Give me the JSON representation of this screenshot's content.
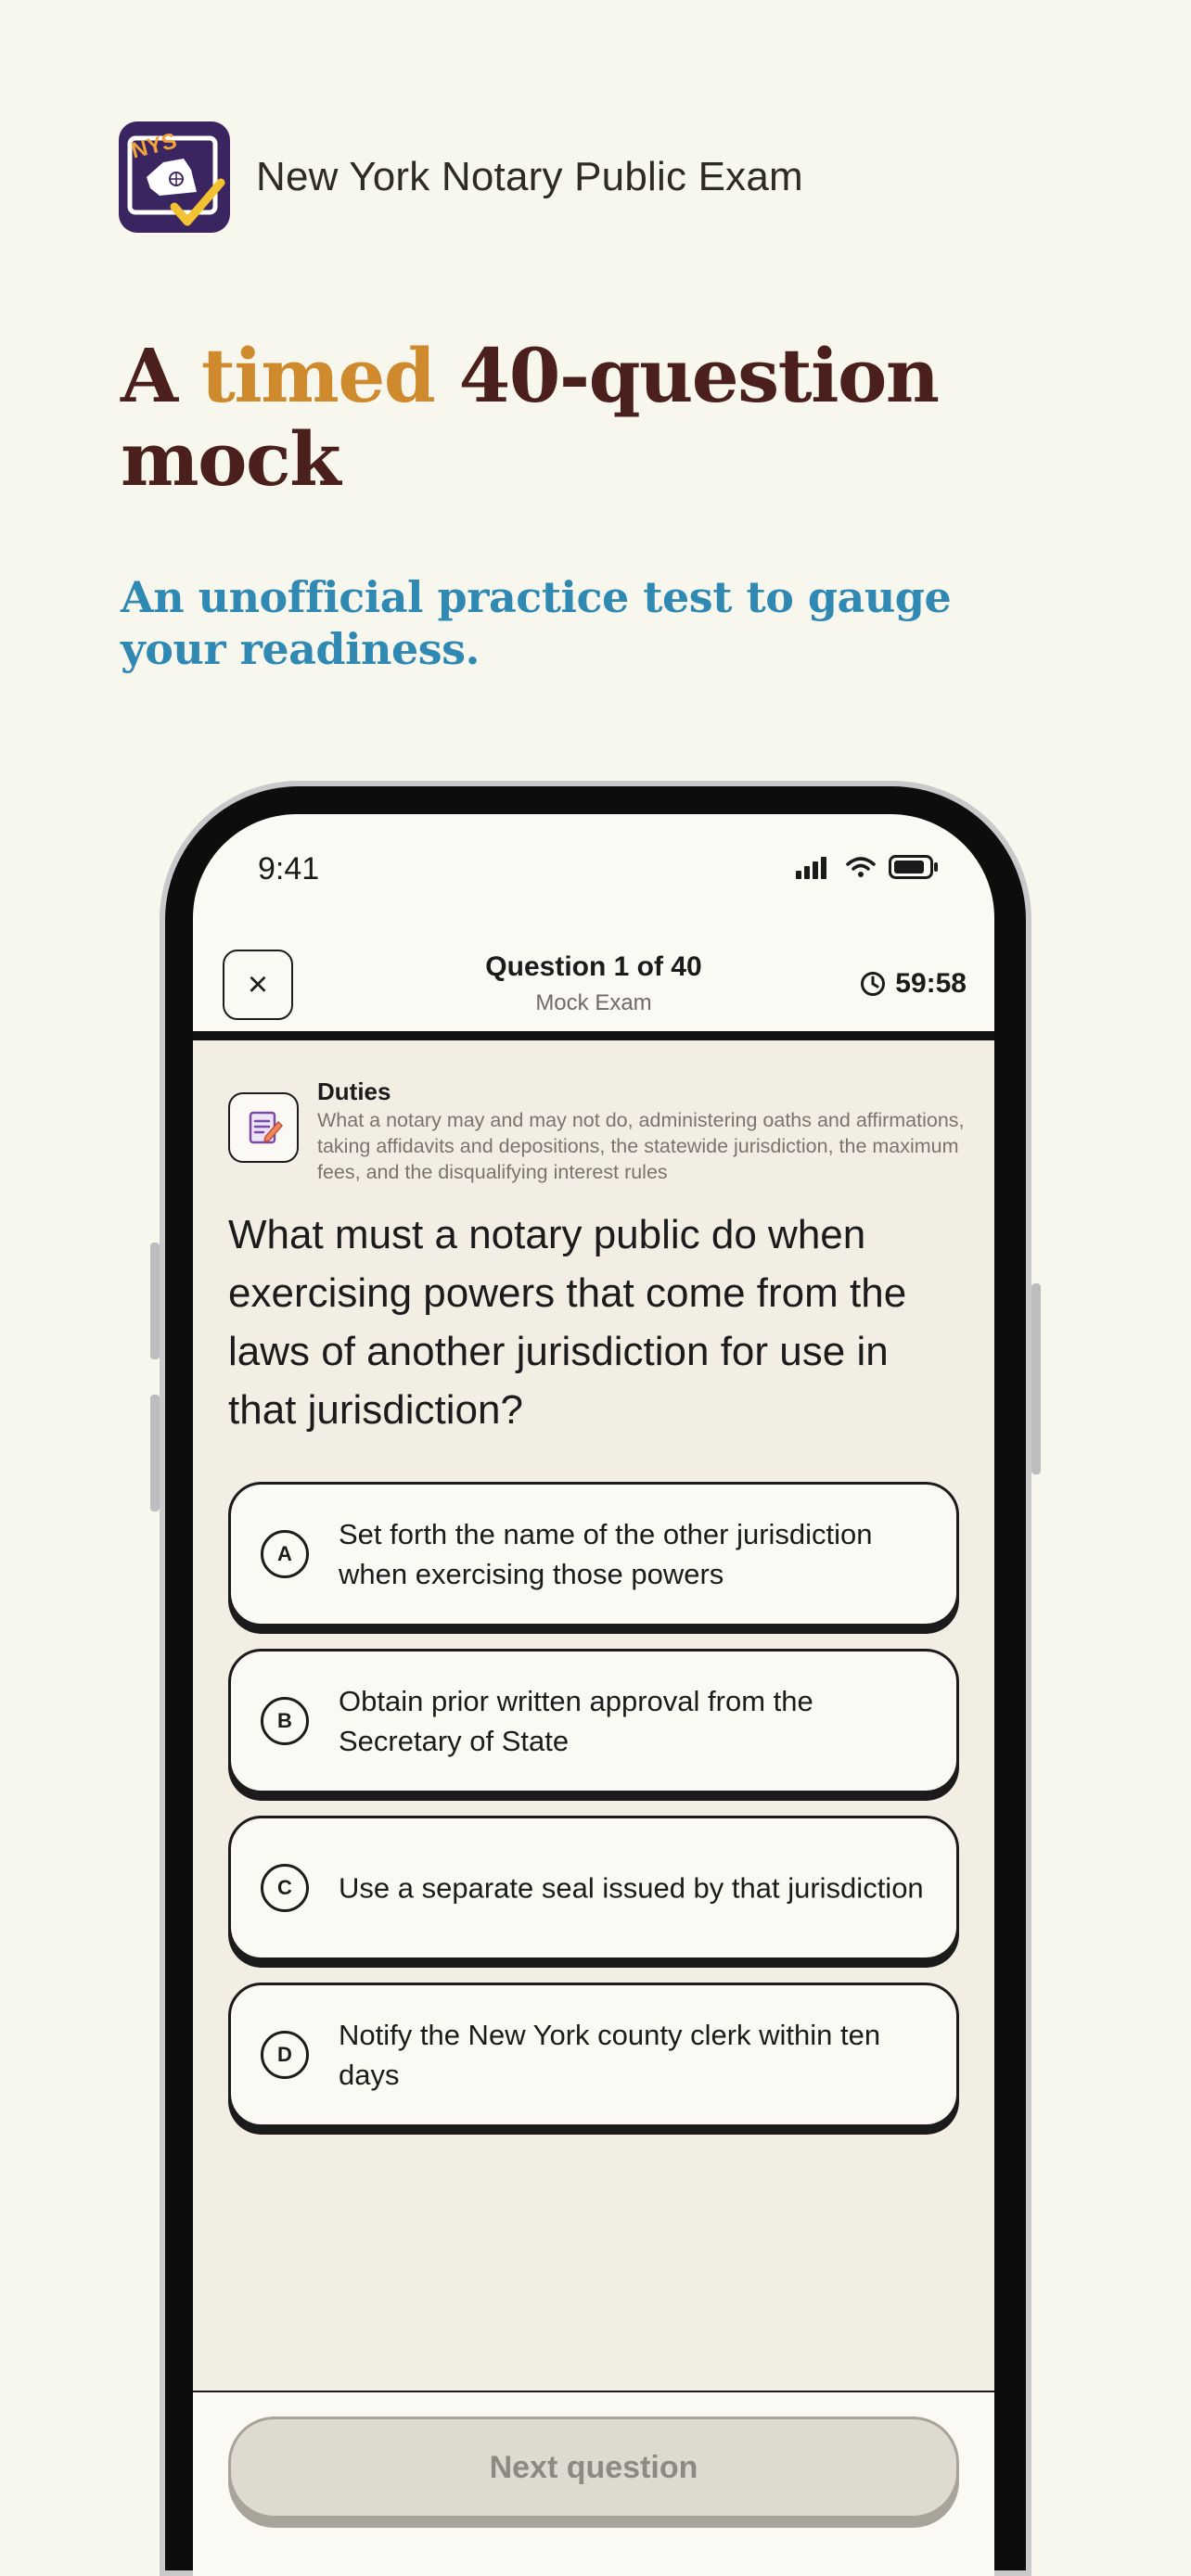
{
  "app": {
    "icon_text": "NYS",
    "title": "New York Notary Public Exam"
  },
  "hero": {
    "headline_pre": "A ",
    "headline_accent": "timed",
    "headline_post": " 40-question mock",
    "subheadline": "An unofficial practice test to gauge your readiness."
  },
  "status_bar": {
    "time": "9:41"
  },
  "quiz_header": {
    "close_icon": "×",
    "counter": "Question 1 of 40",
    "mode": "Mock Exam",
    "timer": "59:58"
  },
  "topic": {
    "name": "Duties",
    "description": "What a notary may and may not do, administering oaths and affirmations, taking affidavits and depositions, the statewide jurisdiction, the maximum fees, and the disqualifying interest rules"
  },
  "question": {
    "text": "What must a notary public do when exercising powers that come from the laws of another jurisdiction for use in that jurisdiction?"
  },
  "options": [
    {
      "letter": "A",
      "text": "Set forth the name of the other jurisdiction when exercising those powers"
    },
    {
      "letter": "B",
      "text": "Obtain prior written approval from the Secretary of State"
    },
    {
      "letter": "C",
      "text": "Use a separate seal issued by that jurisdiction"
    },
    {
      "letter": "D",
      "text": "Notify the New York county clerk within ten days"
    }
  ],
  "footer": {
    "next_label": "Next question"
  },
  "colors": {
    "background": "#f8f7ed",
    "headline": "#4a1f1c",
    "accent": "#cf8a2e",
    "subheadline": "#2f89b3",
    "icon_bg": "#3b2560"
  }
}
